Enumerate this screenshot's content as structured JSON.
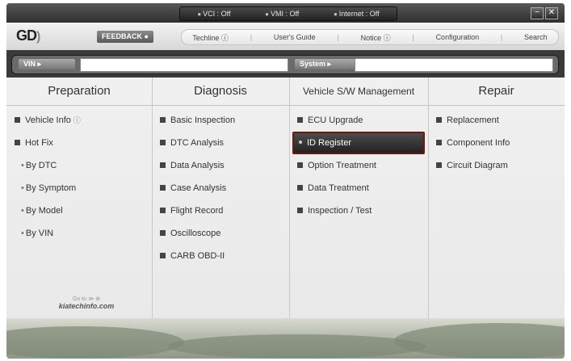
{
  "status": {
    "items": [
      "VCI : Off",
      "VMI : Off",
      "Internet : Off"
    ]
  },
  "window": {
    "minimize_label": "−",
    "close_label": "✕"
  },
  "header": {
    "logo_text": "GD",
    "feedback_label": "FEEDBACK",
    "nav": [
      "Techline",
      "User's Guide",
      "Notice",
      "Configuration",
      "Search"
    ]
  },
  "searchbar": {
    "vin_label": "VIN",
    "vin_value": "",
    "system_label": "System",
    "system_value": ""
  },
  "columns": [
    {
      "title": "Preparation",
      "items": [
        {
          "label": "Vehicle Info",
          "type": "box",
          "info": true
        },
        {
          "label": "Hot Fix",
          "type": "box"
        },
        {
          "label": "By DTC",
          "type": "sub"
        },
        {
          "label": "By Symptom",
          "type": "sub"
        },
        {
          "label": "By Model",
          "type": "sub"
        },
        {
          "label": "By VIN",
          "type": "sub"
        }
      ]
    },
    {
      "title": "Diagnosis",
      "items": [
        {
          "label": "Basic Inspection",
          "type": "box"
        },
        {
          "label": "DTC Analysis",
          "type": "box"
        },
        {
          "label": "Data Analysis",
          "type": "box"
        },
        {
          "label": "Case Analysis",
          "type": "box"
        },
        {
          "label": "Flight Record",
          "type": "box"
        },
        {
          "label": "Oscilloscope",
          "type": "box"
        },
        {
          "label": "CARB OBD-II",
          "type": "box"
        }
      ]
    },
    {
      "title": "Vehicle S/W Management",
      "items": [
        {
          "label": "ECU Upgrade",
          "type": "box"
        },
        {
          "label": "ID Register",
          "type": "selected"
        },
        {
          "label": "Option Treatment",
          "type": "box"
        },
        {
          "label": "Data Treatment",
          "type": "box"
        },
        {
          "label": "Inspection / Test",
          "type": "box"
        }
      ]
    },
    {
      "title": "Repair",
      "items": [
        {
          "label": "Replacement",
          "type": "box"
        },
        {
          "label": "Component Info",
          "type": "box"
        },
        {
          "label": "Circuit Diagram",
          "type": "box"
        }
      ]
    }
  ],
  "promo": {
    "small": "Go to",
    "big": "kiatechinfo.com"
  },
  "colors": {
    "selected_border": "#6a1a10",
    "status_on": "#9adf9a"
  }
}
